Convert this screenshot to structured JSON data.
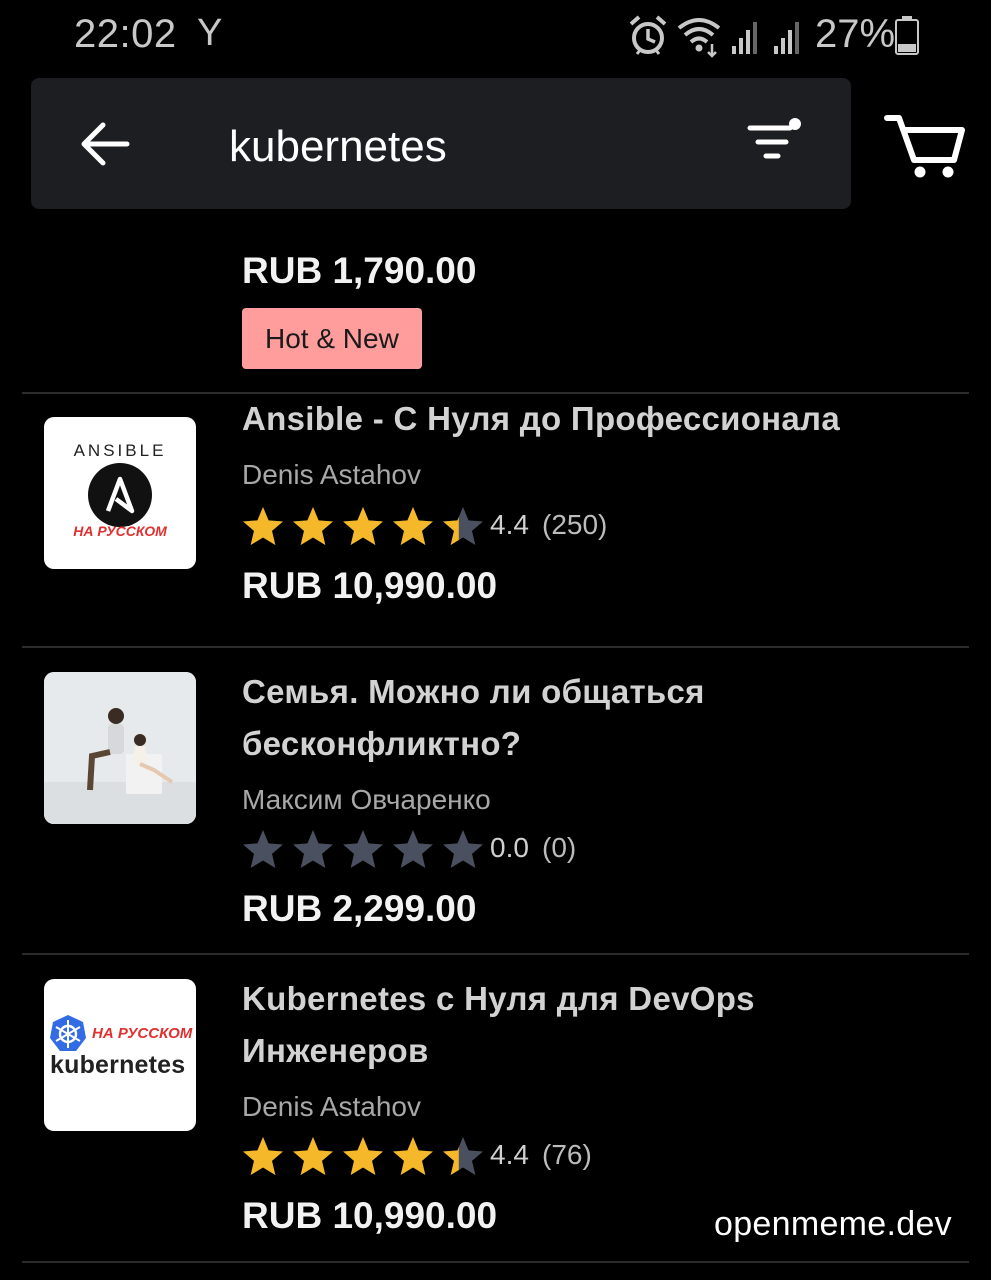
{
  "status_bar": {
    "time": "22:02",
    "carrier_symbol": "Y",
    "battery_percent": "27%",
    "icons": [
      "alarm-icon",
      "wifi-icon",
      "signal-icon",
      "signal-icon",
      "battery-icon"
    ]
  },
  "search": {
    "query": "kubernetes",
    "back_icon": "arrow-left-icon",
    "filter_icon": "filter-icon",
    "cart_icon": "cart-icon"
  },
  "colors": {
    "background": "#000000",
    "search_bar": "#1c1e22",
    "star_filled": "#f5b82a",
    "star_empty": "#4a5060",
    "badge": "#ff9d9d"
  },
  "results": [
    {
      "partial": true,
      "title": "",
      "author": "",
      "rating": null,
      "rating_count": "",
      "price": "RUB 1,790.00",
      "badge": "Hot & New"
    },
    {
      "title_lines": [
        "Ansible - С Нуля до Профессионала"
      ],
      "author": "Denis Astahov",
      "rating": 4.4,
      "rating_text": "4.4",
      "rating_count": "(250)",
      "price": "RUB 10,990.00",
      "thumbnail": {
        "label_top": "ANSIBLE",
        "label_bottom": "НА РУССКОМ",
        "icon": "ansible-logo-icon"
      }
    },
    {
      "title_lines": [
        "Семья. Можно ли общаться",
        "бесконфликтно?"
      ],
      "author": "Максим Овчаренко",
      "rating": 0.0,
      "rating_text": "0.0",
      "rating_count": "(0)",
      "price": "RUB 2,299.00",
      "thumbnail": {
        "icon": "couple-photo-icon"
      }
    },
    {
      "title_lines": [
        "Kubernetes с Нуля для DevOps",
        "Инженеров"
      ],
      "author": "Denis Astahov",
      "rating": 4.4,
      "rating_text": "4.4",
      "rating_count": "(76)",
      "price": "RUB 10,990.00",
      "thumbnail": {
        "label_top": "НА РУССКОМ",
        "label_bottom": "kubernetes",
        "icon": "kubernetes-logo-icon"
      }
    }
  ],
  "watermark": "openmeme.dev"
}
